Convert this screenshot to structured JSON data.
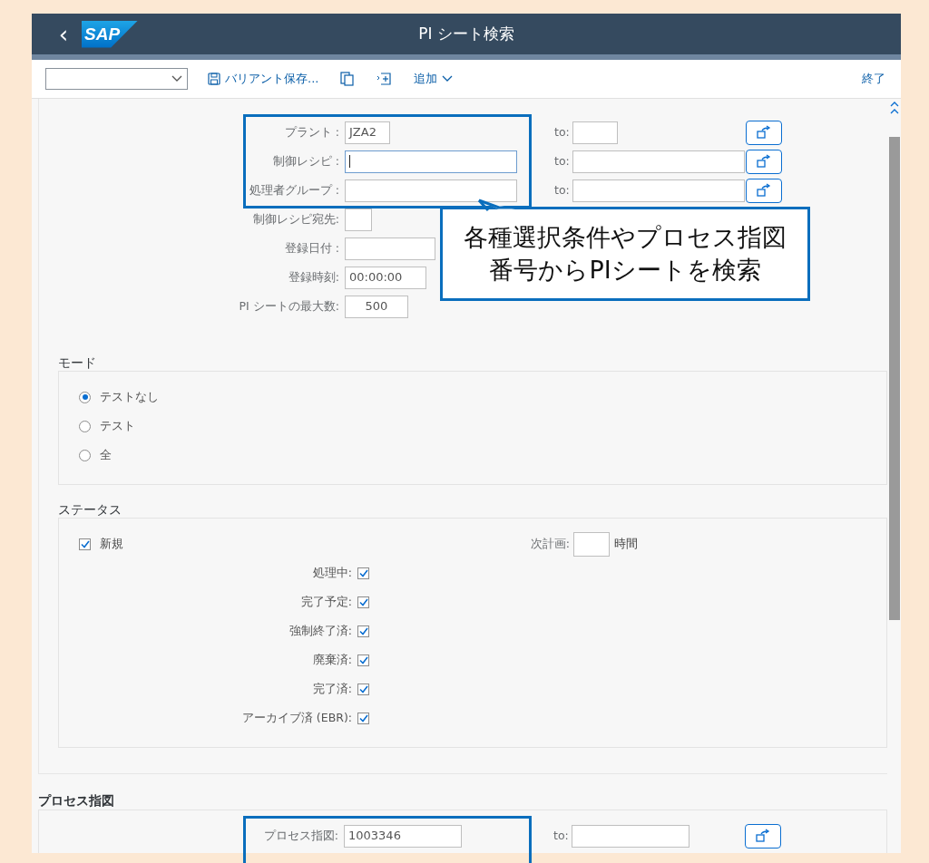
{
  "header": {
    "back": "‹",
    "logo": "SAP",
    "title": "PI シート検索"
  },
  "toolbar": {
    "save_variant": "バリアント保存...",
    "add": "追加",
    "exit": "終了"
  },
  "fields": [
    {
      "label": "プラント :",
      "value": "JZA2",
      "kind": "short",
      "to_label": "to:",
      "focused": false
    },
    {
      "label": "制御レシピ :",
      "kind": "long",
      "to_label": "to:",
      "focused": true
    },
    {
      "label": "処理者グループ :",
      "kind": "long",
      "to_label": "to:",
      "focused": false
    },
    {
      "label": "制御レシピ宛先:",
      "kind": "tiny",
      "focused": false
    },
    {
      "label": "登録日付 :",
      "kind": "date",
      "focused": false
    },
    {
      "label": "登録時刻:",
      "value": "00:00:00",
      "kind": "time",
      "focused": false
    },
    {
      "label": "PI シートの最大数:",
      "value": "500",
      "kind": "number",
      "focused": false
    }
  ],
  "mode": {
    "title": "モード",
    "options": [
      {
        "label": "テストなし",
        "selected": true
      },
      {
        "label": "テスト",
        "selected": false
      },
      {
        "label": "全",
        "selected": false
      }
    ]
  },
  "status": {
    "title": "ステータス",
    "primary": {
      "label": "新規",
      "checked": true
    },
    "next_plan": {
      "label": "次計画:",
      "unit": "時間"
    },
    "items": [
      {
        "label": "処理中:",
        "checked": true
      },
      {
        "label": "完了予定:",
        "checked": true
      },
      {
        "label": "強制終了済:",
        "checked": true
      },
      {
        "label": "廃棄済:",
        "checked": true
      },
      {
        "label": "完了済:",
        "checked": true
      },
      {
        "label": "アーカイブ済 (EBR):",
        "checked": true
      }
    ]
  },
  "process_order": {
    "title": "プロセス指図",
    "label": "プロセス指図:",
    "value": "1003346",
    "to_label": "to:"
  },
  "callout": {
    "lines": [
      "各種選択条件やプロセス指図",
      "番号からPIシートを検索"
    ]
  }
}
